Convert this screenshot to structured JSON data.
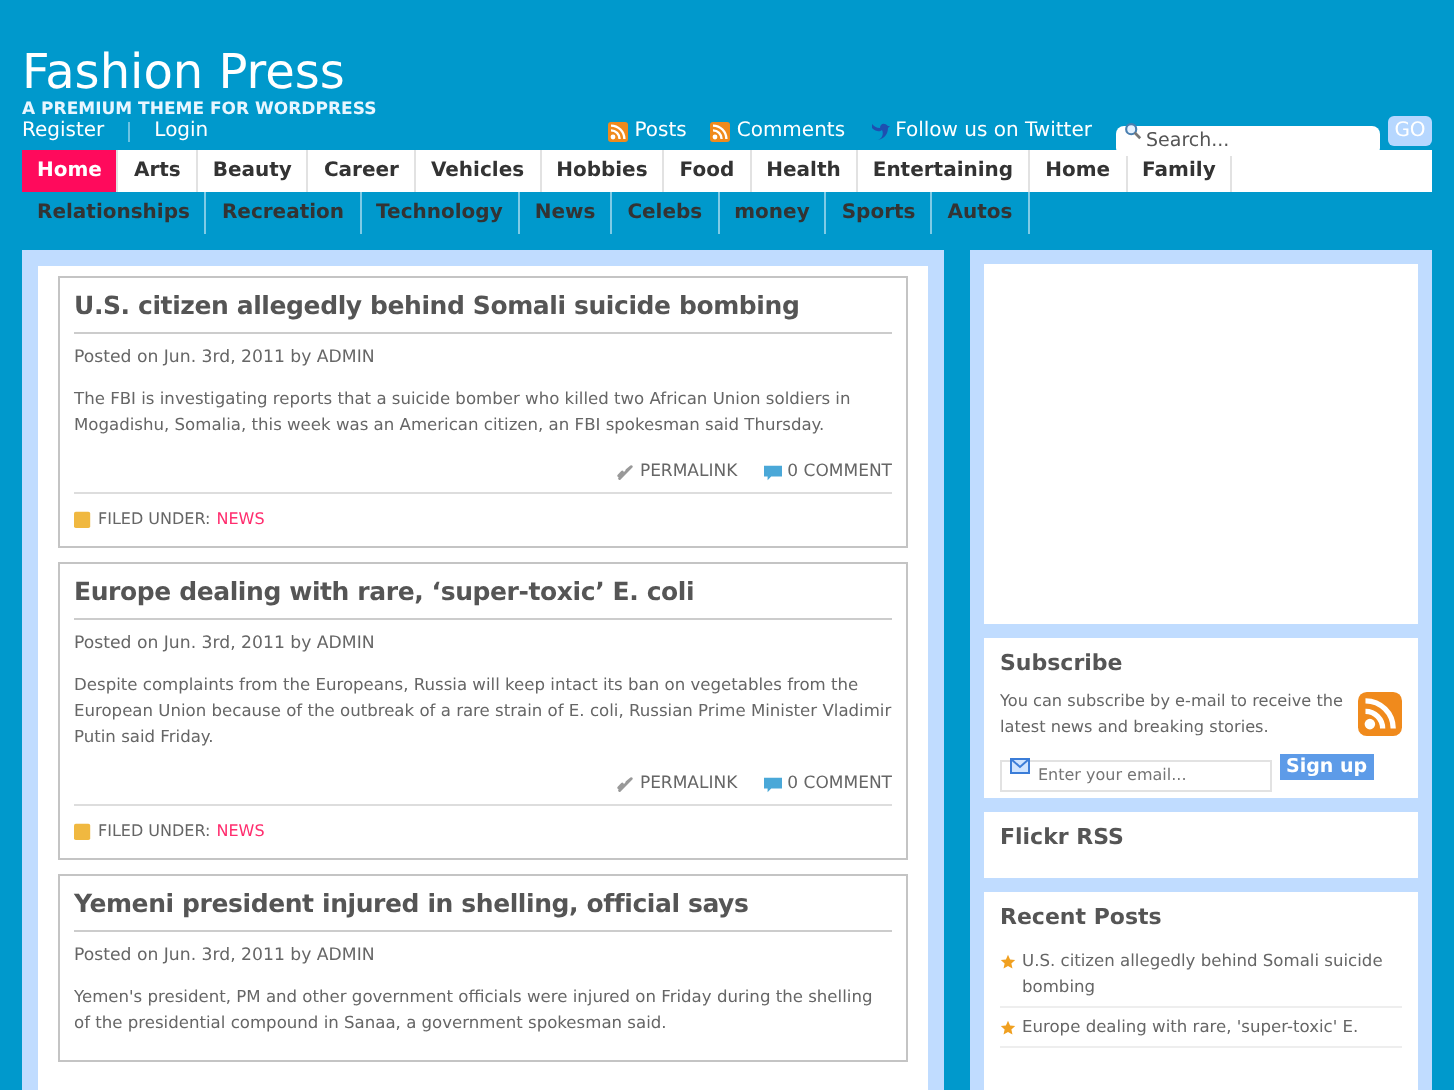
{
  "site": {
    "title": "Fashion Press",
    "tagline": "A PREMIUM THEME FOR WORDPRESS"
  },
  "top_links": [
    "Register",
    "Login"
  ],
  "feeds": [
    {
      "kind": "rss",
      "label": "Posts"
    },
    {
      "kind": "rss",
      "label": "Comments"
    },
    {
      "kind": "twitter",
      "label": "Follow us on Twitter"
    }
  ],
  "search": {
    "placeholder": "Search...",
    "button": "GO"
  },
  "menu_rows": [
    [
      {
        "label": "Home",
        "selected": true
      },
      {
        "label": "Arts",
        "selected": false
      },
      {
        "label": "Beauty",
        "selected": false
      },
      {
        "label": "Career",
        "selected": false
      },
      {
        "label": "Vehicles",
        "selected": false
      },
      {
        "label": "Hobbies",
        "selected": false
      },
      {
        "label": "Food",
        "selected": false
      },
      {
        "label": "Health",
        "selected": false
      },
      {
        "label": "Entertaining",
        "selected": false
      },
      {
        "label": "Home",
        "selected": false
      },
      {
        "label": "Family",
        "selected": false
      }
    ],
    [
      {
        "label": "Relationships",
        "selected": false
      },
      {
        "label": "Recreation",
        "selected": false
      },
      {
        "label": "Technology",
        "selected": false
      },
      {
        "label": "News",
        "selected": false
      },
      {
        "label": "Celebs",
        "selected": false
      },
      {
        "label": "money",
        "selected": false
      },
      {
        "label": "Sports",
        "selected": false
      },
      {
        "label": "Autos",
        "selected": false
      }
    ]
  ],
  "posts": [
    {
      "title": "U.S. citizen allegedly behind Somali suicide bombing",
      "meta": "Posted on Jun. 3rd, 2011 by ADMIN",
      "excerpt": "The FBI is investigating reports that a suicide bomber who killed two African Union soldiers in Mogadishu, Somalia, this week was an American citizen, an FBI spokesman said Thursday.",
      "permalink": "PERMALINK",
      "comments": "0 COMMENT",
      "filed_label": "FILED UNDER:",
      "category": "NEWS"
    },
    {
      "title": "Europe dealing with rare, ‘super-toxic’ E. coli",
      "meta": "Posted on Jun. 3rd, 2011 by ADMIN",
      "excerpt": "Despite complaints from the Europeans, Russia will keep intact its ban on vegetables from the European Union because of the outbreak of a rare strain of E. coli, Russian Prime Minister Vladimir Putin said Friday.",
      "permalink": "PERMALINK",
      "comments": "0 COMMENT",
      "filed_label": "FILED UNDER:",
      "category": "NEWS"
    },
    {
      "title": "Yemeni president injured in shelling, official says",
      "meta": "Posted on Jun. 3rd, 2011 by ADMIN",
      "excerpt": "Yemen's president, PM and other government officials were injured on Friday during the shelling of the presidential compound in Sanaa, a government spokesman said."
    }
  ],
  "subscribe": {
    "title": "Subscribe",
    "text": "You can subscribe by e-mail to receive the latest news and breaking stories.",
    "placeholder": "Enter your email...",
    "button": "Sign up"
  },
  "flickr": {
    "title": "Flickr RSS"
  },
  "recent_posts": {
    "title": "Recent Posts",
    "items": [
      "U.S. citizen allegedly behind Somali suicide bombing",
      "Europe dealing with rare, 'super-toxic' E."
    ]
  }
}
